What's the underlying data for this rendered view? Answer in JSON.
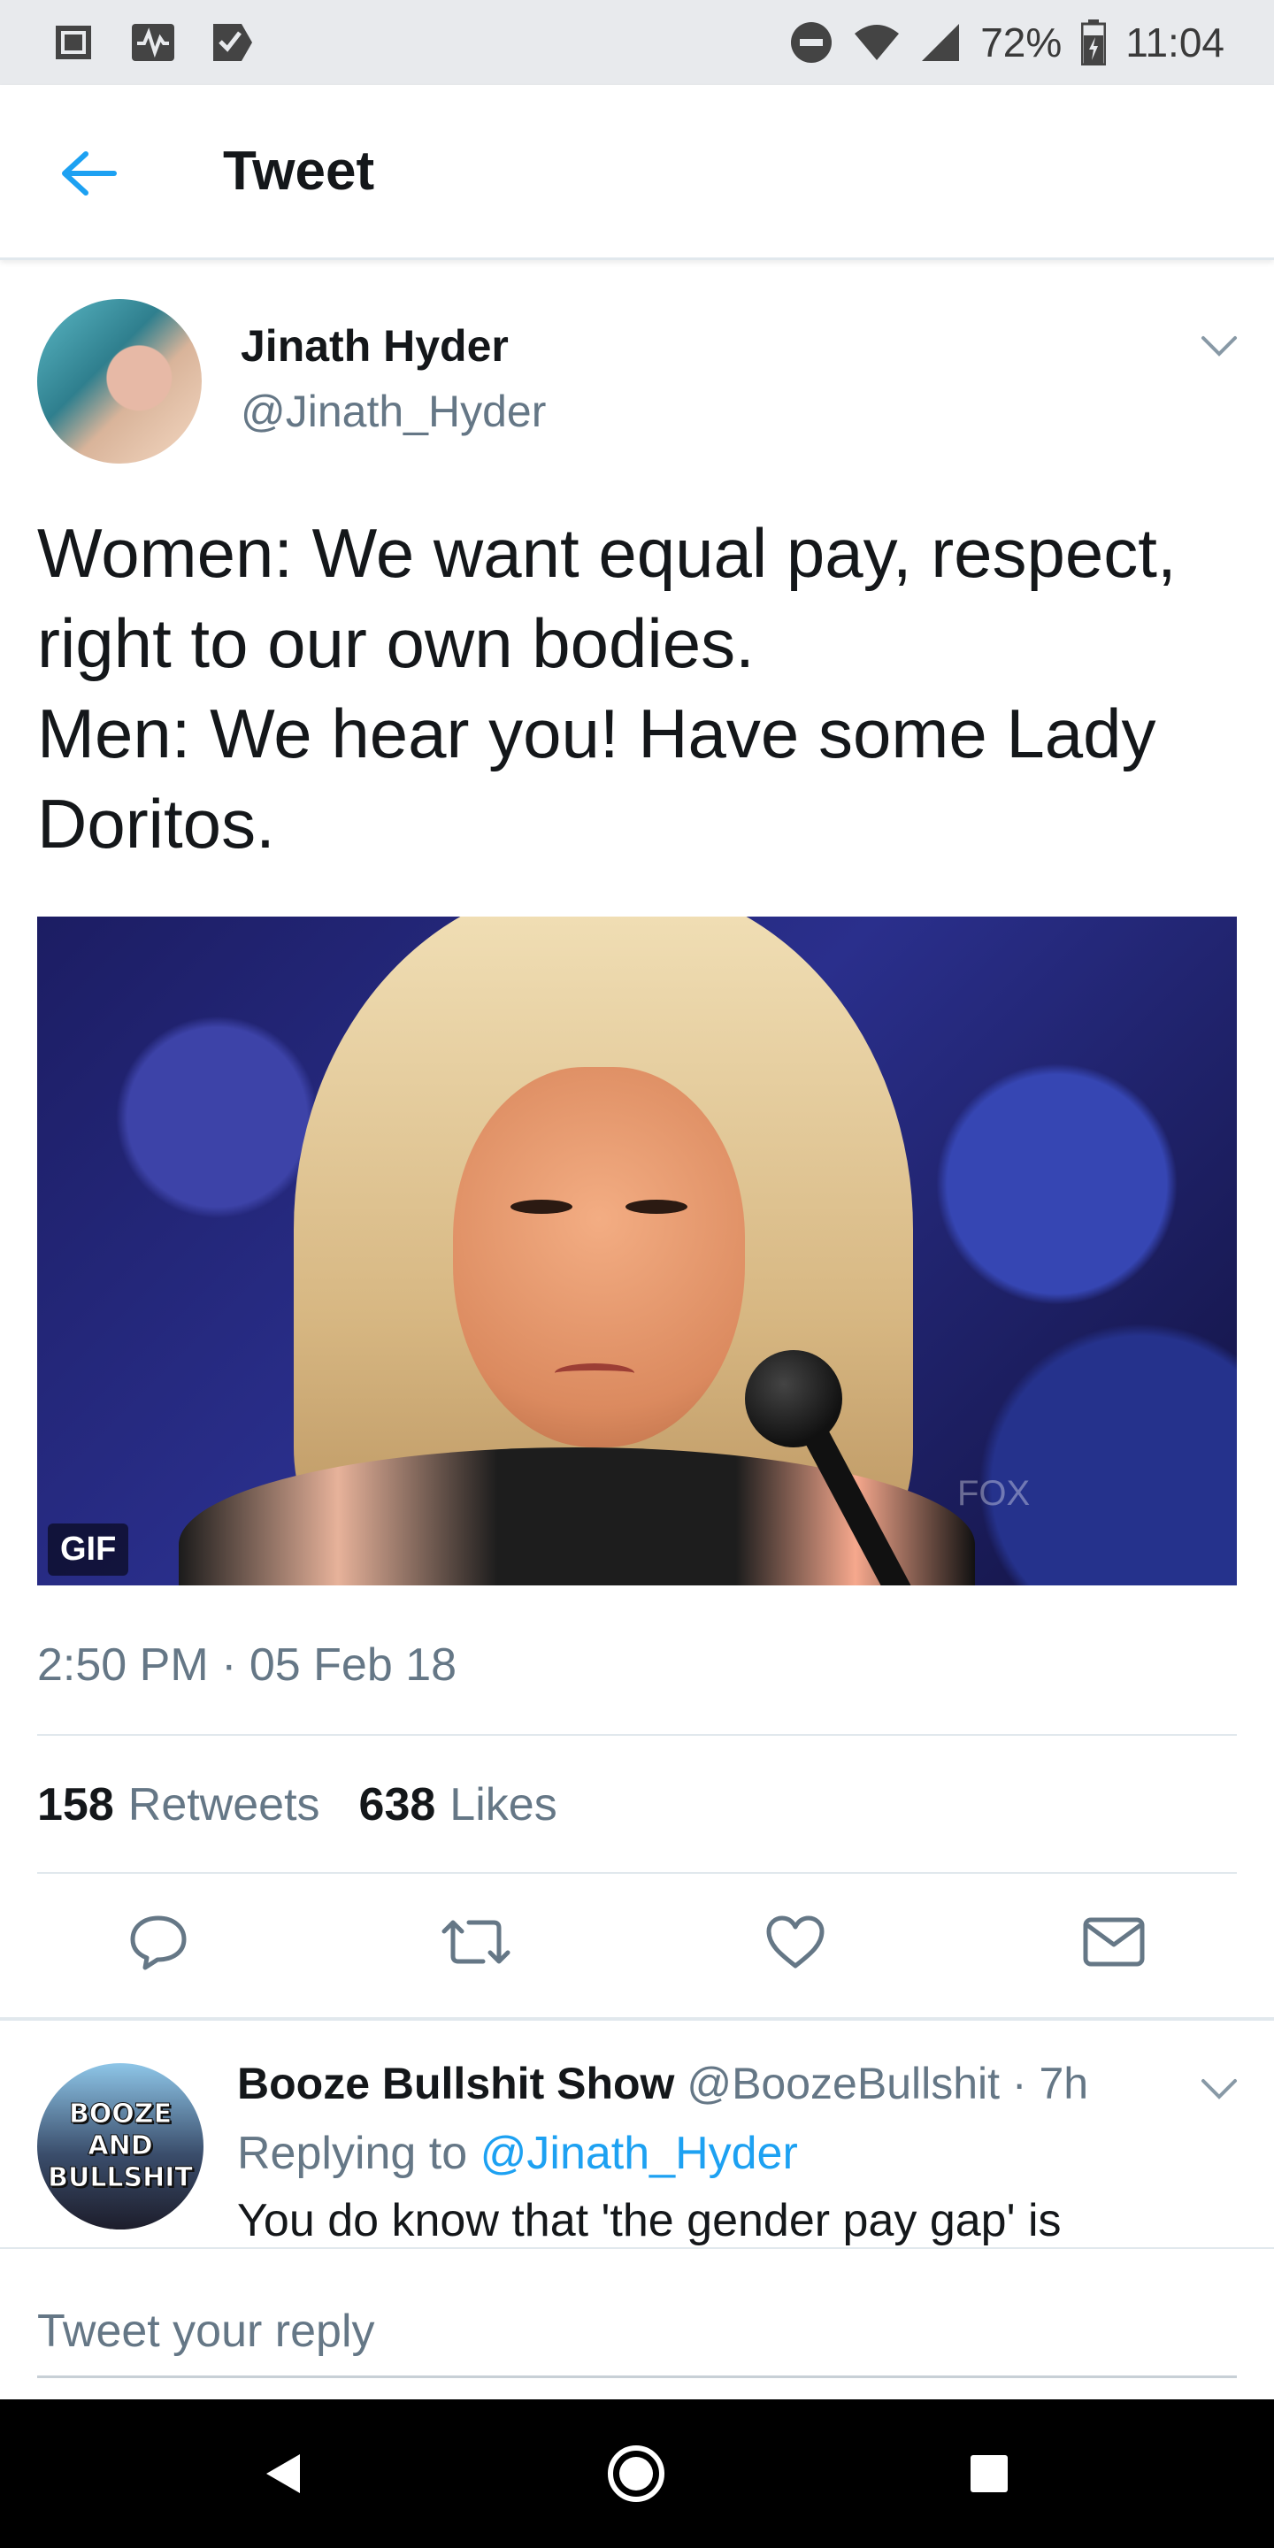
{
  "status_bar": {
    "battery": "72%",
    "time": "11:04",
    "icons": [
      "notification-icon",
      "activity-icon",
      "check-icon",
      "do-not-disturb-icon",
      "wifi-icon",
      "signal-icon",
      "battery-icon"
    ]
  },
  "header": {
    "title": "Tweet",
    "back_icon": "arrow-left-icon"
  },
  "tweet": {
    "author_name": "Jinath Hyder",
    "author_handle": "@Jinath_Hyder",
    "text": "Women: We want equal pay, respect, right to our own bodies.\nMen: We hear you! Have some Lady Doritos.",
    "media": {
      "badge": "GIF",
      "watermark": "FOX"
    },
    "timestamp": "2:50 PM · 05 Feb 18",
    "retweets_count": "158",
    "retweets_label": "Retweets",
    "likes_count": "638",
    "likes_label": "Likes"
  },
  "actions": [
    "reply-icon",
    "retweet-icon",
    "like-icon",
    "message-icon"
  ],
  "reply": {
    "avatar_text": "BOOZE\nAND\nBULLSHIT",
    "author_name": "Booze Bullshit Show",
    "meta": " @BoozeBullshit · 7h",
    "replying_label": "Replying to ",
    "replying_handle": "@Jinath_Hyder",
    "text": "You do know that 'the gender pay gap' is"
  },
  "compose": {
    "placeholder": "Tweet your reply"
  },
  "colors": {
    "accent": "#1da1f2",
    "secondary_text": "#657786",
    "primary_text": "#14171a"
  }
}
